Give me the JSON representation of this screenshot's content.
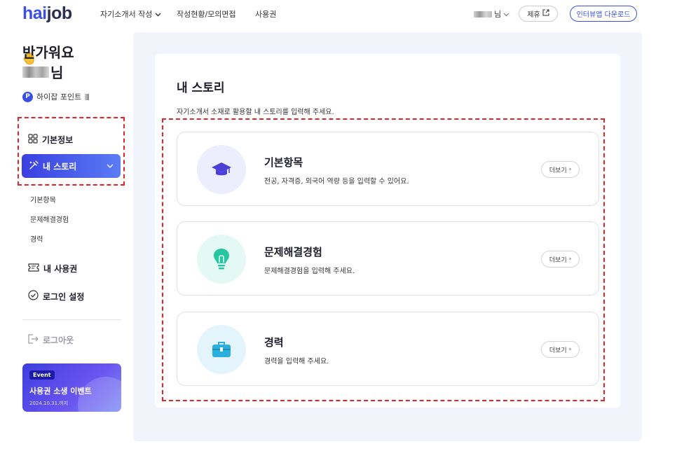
{
  "header": {
    "logo_hai": "hai",
    "logo_job": "job",
    "nav": [
      "자기소개서 작성",
      "작성현황/모의면접",
      "사용권"
    ],
    "user_suffix": "님",
    "partner_label": "제휴",
    "download_label": "인터뷰앱 다운로드"
  },
  "sidebar": {
    "greeting": "반가워요",
    "name_suffix": "님",
    "points_badge": "P",
    "points_label": "하이잡 포인트",
    "menu": {
      "basic_info": "기본정보",
      "my_story": "내 스토리",
      "sub_items": [
        "기본항목",
        "문제해결경험",
        "경력"
      ],
      "my_ticket": "내 사용권",
      "login_settings": "로그인 설정",
      "logout": "로그아웃"
    },
    "event": {
      "tag": "Event",
      "title": "사용권 소생 이벤트",
      "date": "2024.10.31.까지"
    }
  },
  "main": {
    "title": "내 스토리",
    "description": "자기소개서 소재로 활용할 내 스토리를 입력해 주세요.",
    "cards": [
      {
        "title": "기본항목",
        "desc": "전공, 자격증, 외국어 역량 등을 입력할 수 있어요.",
        "more": "더보기",
        "icon": "graduation-cap-icon",
        "color": "#4b3fd6"
      },
      {
        "title": "문제해결경험",
        "desc": "문제해결경험을 입력해 주세요.",
        "more": "더보기",
        "icon": "lightbulb-icon",
        "color": "#25c7a0"
      },
      {
        "title": "경력",
        "desc": "경력을 입력해 주세요.",
        "more": "더보기",
        "icon": "briefcase-icon",
        "color": "#2bb0dd"
      }
    ]
  },
  "colors": {
    "accent": "#3b4fe4",
    "highlight_border": "#e0262b",
    "main_bg": "#f2f4fb"
  }
}
